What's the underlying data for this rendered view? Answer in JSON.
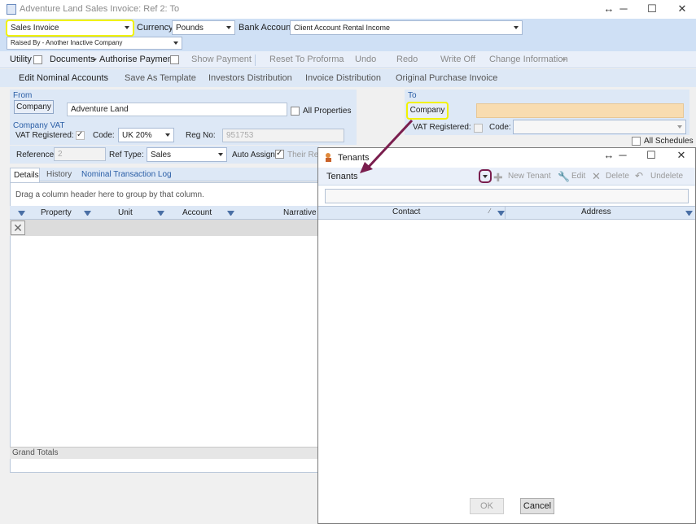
{
  "window": {
    "title": "Adventure Land Sales Invoice: Ref 2: To"
  },
  "header": {
    "doc_type": "Sales Invoice",
    "currency_label": "Currency",
    "currency": "Pounds",
    "bank_label": "Bank Account",
    "bank": "Client Account Rental Income",
    "raised_by": "Raised By - Another Inactive Company"
  },
  "toolbar1": {
    "utility": "Utility",
    "documents": "Documents",
    "authorise": "Authorise Payment",
    "show_payment": "Show Payment",
    "reset": "Reset To Proforma",
    "undo": "Undo",
    "redo": "Redo",
    "write_off": "Write Off",
    "change_info": "Change Information"
  },
  "toolbar2": {
    "edit_nominal": "Edit Nominal Accounts",
    "save_template": "Save As Template",
    "investors": "Investors Distribution",
    "invoice_dist": "Invoice Distribution",
    "original_purchase": "Original Purchase Invoice"
  },
  "from": {
    "section": "From",
    "company_btn": "Company",
    "company_name": "Adventure Land",
    "all_properties": "All Properties",
    "vat_section": "Company VAT",
    "vat_registered": "VAT Registered:",
    "code_label": "Code:",
    "code": "UK 20%",
    "reg_label": "Reg No:",
    "reg": "951753"
  },
  "to": {
    "section": "To",
    "company_btn": "Company",
    "vat_registered": "VAT Registered:",
    "code_label": "Code:",
    "all_schedules": "All Schedules"
  },
  "ref": {
    "reference_label": "Reference:",
    "reference": "2",
    "type_label": "Ref Type:",
    "type": "Sales",
    "auto_assign": "Auto Assign:",
    "their_ref": "Their Ref"
  },
  "tabs": [
    "Details",
    "History",
    "Nominal Transaction Log"
  ],
  "grid": {
    "group_hint": "Drag a column header here to group by that column.",
    "columns": [
      "Property",
      "Unit",
      "Account",
      "Narrative"
    ],
    "grand_totals": "Grand Totals"
  },
  "dialog": {
    "title": "Tenants",
    "combo": "Tenants",
    "new_tenant": "New Tenant",
    "edit": "Edit",
    "delete": "Delete",
    "undelete": "Undelete",
    "columns": [
      "Contact",
      "Address"
    ],
    "ok": "OK",
    "cancel": "Cancel"
  },
  "colors": {
    "highlight": "#f2f200",
    "annotation": "#7a1e4e",
    "to_company_field": "#f8dcb0"
  }
}
